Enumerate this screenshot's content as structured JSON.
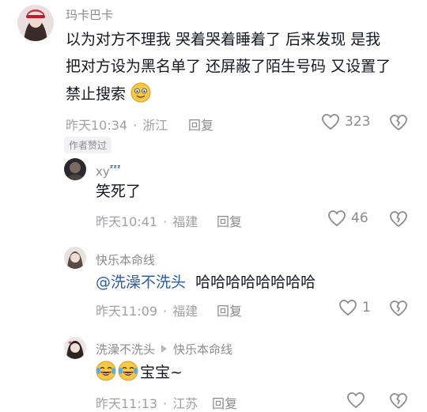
{
  "comments": [
    {
      "username": "玛卡巴卡",
      "text_line1": "以为对方不理我 哭着哭着睡着了 后来发现 是我",
      "text_line2": "把对方设为黑名单了 还屏蔽了陌生号码 又设置了",
      "text_line3": "禁止搜索",
      "time": "昨天10:34",
      "location": "浙江",
      "reply_label": "回复",
      "likes": "323",
      "badge": "作者赞过"
    },
    {
      "username": "xy",
      "text": "笑死了",
      "time": "昨天10:41",
      "location": "福建",
      "reply_label": "回复",
      "likes": "46"
    },
    {
      "username": "快乐本命线",
      "mention": "@洗澡不洗头",
      "text": "哈哈哈哈哈哈哈哈",
      "time": "昨天11:09",
      "location": "福建",
      "reply_label": "回复",
      "likes": "1"
    },
    {
      "username": "洗澡不洗头",
      "reply_to": "快乐本命线",
      "text": "宝宝~",
      "time": "昨天11:13",
      "location": "江苏",
      "reply_label": "回复"
    }
  ],
  "dot": "·",
  "colors": {
    "meta": "#a0a1a6",
    "mention": "#2b5e9f",
    "heart": "#8a8b91"
  }
}
